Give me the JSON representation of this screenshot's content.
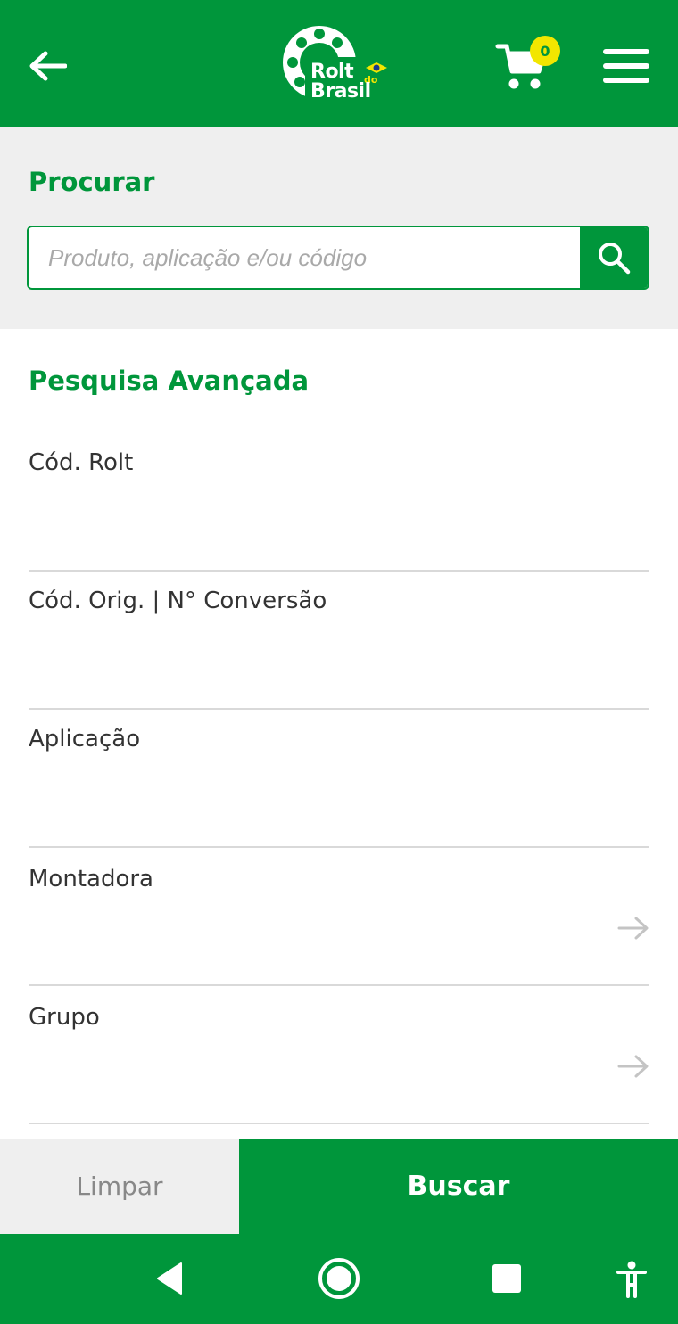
{
  "header": {
    "logo_line1": "Rolt",
    "logo_do": "do",
    "logo_line2": "Brasil",
    "cart_count": "0",
    "back_icon": "arrow-left-icon",
    "cart_icon": "cart-icon",
    "menu_icon": "hamburger-icon"
  },
  "search": {
    "title": "Procurar",
    "placeholder": "Produto, aplicação e/ou código",
    "button_icon": "search-icon"
  },
  "advanced": {
    "title": "Pesquisa Avançada",
    "fields": [
      {
        "label": "Cód. Rolt",
        "value": ""
      },
      {
        "label": "Cód. Orig. | N° Conversão",
        "value": ""
      },
      {
        "label": "Aplicação",
        "value": ""
      },
      {
        "label": "Montadora",
        "value": "",
        "icon": "arrow-right-icon"
      },
      {
        "label": "Grupo",
        "value": "",
        "icon": "arrow-right-icon"
      }
    ]
  },
  "actions": {
    "clear_label": "Limpar",
    "submit_label": "Buscar"
  },
  "system_nav": {
    "items": [
      "back-triangle-icon",
      "home-circle-icon",
      "recents-square-icon",
      "accessibility-icon"
    ]
  },
  "colors": {
    "brand_green": "#00963b",
    "badge_yellow": "#f2e600",
    "light_gray": "#efefef",
    "divider": "#d9d9d9"
  }
}
